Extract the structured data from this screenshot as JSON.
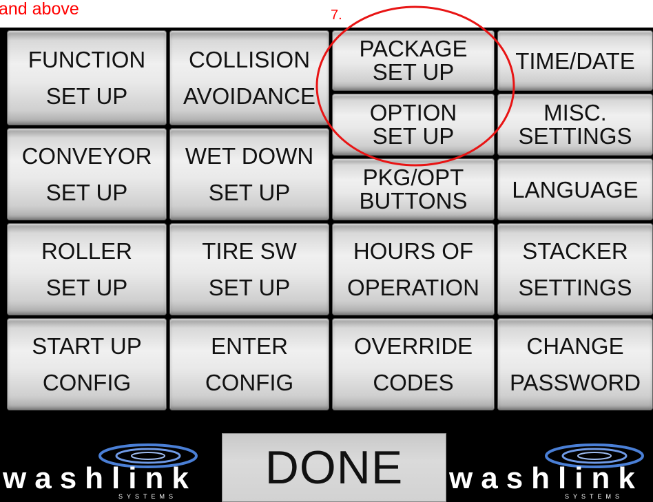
{
  "annotation": {
    "caption": "and above",
    "step_number": "7.",
    "highlight_color": "#ff0000"
  },
  "menu": {
    "function_setup": [
      "FUNCTION",
      "SET UP"
    ],
    "collision_avoidance": [
      "COLLISION",
      "AVOIDANCE"
    ],
    "package_setup": [
      "PACKAGE",
      "SET UP"
    ],
    "time_date": [
      "TIME/DATE"
    ],
    "option_setup": [
      "OPTION",
      "SET UP"
    ],
    "misc_settings": [
      "MISC.",
      "SETTINGS"
    ],
    "conveyor_setup": [
      "CONVEYOR",
      "SET UP"
    ],
    "wet_down_setup": [
      "WET DOWN",
      "SET UP"
    ],
    "pkg_opt_buttons": [
      "PKG/OPT",
      "BUTTONS"
    ],
    "language": [
      "LANGUAGE"
    ],
    "roller_setup": [
      "ROLLER",
      "SET UP"
    ],
    "tire_sw_setup": [
      "TIRE SW",
      "SET UP"
    ],
    "hours_of_operation": [
      "HOURS OF",
      "OPERATION"
    ],
    "stacker_settings": [
      "STACKER",
      "SETTINGS"
    ],
    "start_up_config": [
      "START UP",
      "CONFIG"
    ],
    "enter_config": [
      "ENTER",
      "CONFIG"
    ],
    "override_codes": [
      "OVERRIDE",
      "CODES"
    ],
    "change_password": [
      "CHANGE",
      "PASSWORD"
    ]
  },
  "done_label": "DONE",
  "logo": {
    "word": "washlink",
    "sub": "SYSTEMS"
  },
  "colors": {
    "panel_bg": "#000000",
    "button_face": "#e6e6e6",
    "button_text": "#111111"
  }
}
